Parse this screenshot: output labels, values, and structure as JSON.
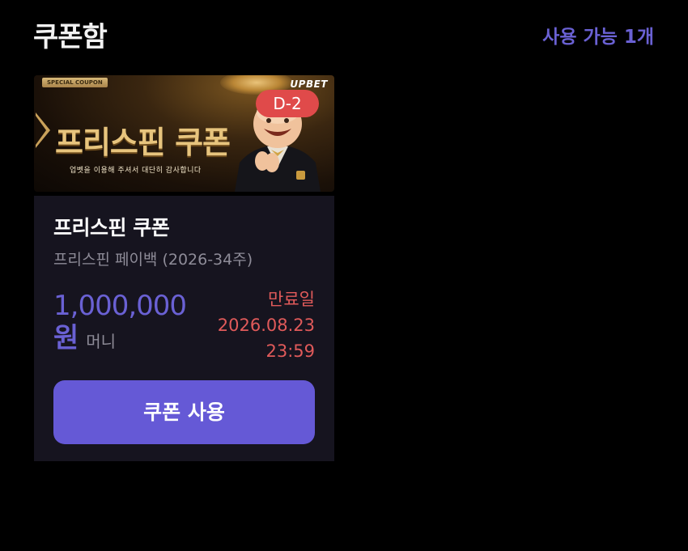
{
  "header": {
    "title": "쿠폰함",
    "available_count": "사용 가능 1개"
  },
  "coupon": {
    "banner": {
      "tag": "SPECIAL COUPON",
      "brand": "UPBET",
      "headline": "프리스핀 쿠폰",
      "subtext": "업벳을 이용해 주셔서 대단히 감사합니다",
      "d_day": "D-2"
    },
    "name": "프리스핀 쿠폰",
    "description": "프리스핀 페이백 (2026-34주)",
    "amount": "1,000,000",
    "amount_unit": "원",
    "money_type": "머니",
    "expiry_label": "만료일",
    "expiry_date": "2026.08.23",
    "expiry_time": "23:59",
    "use_button_label": "쿠폰 사용"
  },
  "colors": {
    "background": "#000000",
    "accent": "#6559d6",
    "card": "#16141f",
    "expiry": "#e05a5a",
    "badge": "#e04a4a"
  }
}
